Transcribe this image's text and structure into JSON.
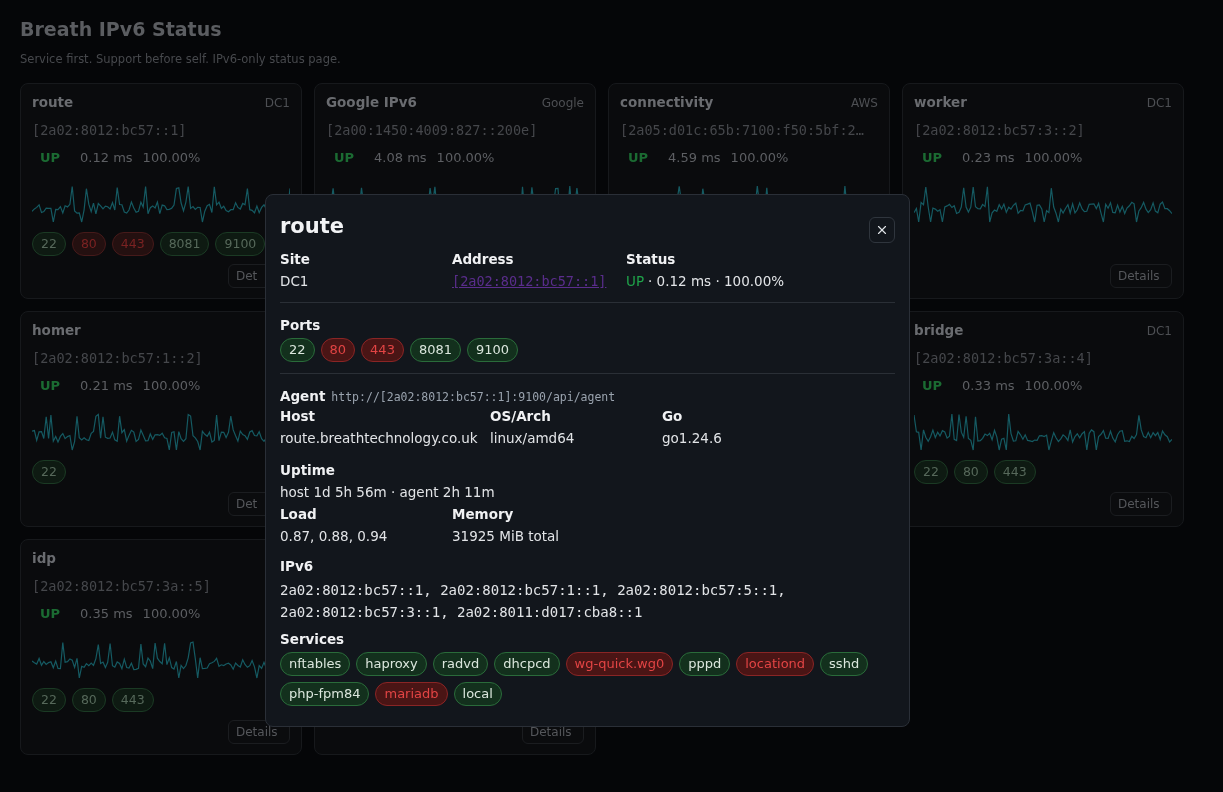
{
  "header": {
    "title": "Breath IPv6 Status",
    "subtitle": "Service first. Support before self. IPv6-only status page."
  },
  "cards": [
    {
      "kind": "monitor",
      "name": "route",
      "site": "DC1",
      "address": "[2a02:8012:bc57::1]",
      "status": {
        "state": "UP",
        "ok": true,
        "latency": "0.12 ms",
        "uptime": "100.00%"
      },
      "ports": [
        {
          "label": "22",
          "open": true
        },
        {
          "label": "80",
          "open": false
        },
        {
          "label": "443",
          "open": false
        },
        {
          "label": "8081",
          "open": true
        },
        {
          "label": "9100",
          "open": true
        }
      ],
      "details": "Det"
    },
    {
      "kind": "monitor",
      "name": "Google IPv6",
      "site": "Google",
      "address": "[2a00:1450:4009:827::200e]",
      "status": {
        "state": "UP",
        "ok": true,
        "latency": "4.08 ms",
        "uptime": "100.00%"
      }
    },
    {
      "kind": "monitor",
      "name": "connectivity",
      "site": "AWS",
      "address": "[2a05:d01c:65b:7100:f50:5bf:2…",
      "status": {
        "state": "UP",
        "ok": true,
        "latency": "4.59 ms",
        "uptime": "100.00%"
      }
    },
    {
      "kind": "monitor",
      "name": "worker",
      "site": "DC1",
      "address": "[2a02:8012:bc57:3::2]",
      "status": {
        "state": "UP",
        "ok": true,
        "latency": "0.23 ms",
        "uptime": "100.00%"
      },
      "details": "Details"
    },
    {
      "kind": "monitor",
      "name": "homer",
      "address": "[2a02:8012:bc57:1::2]",
      "status": {
        "state": "UP",
        "ok": true,
        "latency": "0.21 ms",
        "uptime": "100.00%"
      },
      "ports": [
        {
          "label": "22",
          "open": true
        }
      ],
      "details": "Det"
    },
    {
      "kind": "blank"
    },
    {
      "kind": "blank"
    },
    {
      "kind": "monitor",
      "name": "bridge",
      "site": "DC1",
      "address": "[2a02:8012:bc57:3a::4]",
      "status": {
        "state": "UP",
        "ok": true,
        "latency": "0.33 ms",
        "uptime": "100.00%"
      },
      "ports": [
        {
          "label": "22",
          "open": true
        },
        {
          "label": "80",
          "open": true
        },
        {
          "label": "443",
          "open": true
        }
      ],
      "details": "Details"
    },
    {
      "kind": "monitor",
      "name": "idp",
      "address": "[2a02:8012:bc57:3a::5]",
      "status": {
        "state": "UP",
        "ok": true,
        "latency": "0.35 ms",
        "uptime": "100.00%"
      },
      "ports": [
        {
          "label": "22",
          "open": true
        },
        {
          "label": "80",
          "open": true
        },
        {
          "label": "443",
          "open": true
        }
      ],
      "details": "Details"
    },
    {
      "kind": "monitor",
      "details": "Details"
    }
  ],
  "dialog": {
    "title": "route",
    "fields": [
      {
        "kind": "text",
        "label": "Site",
        "value": "DC1"
      },
      {
        "kind": "link",
        "label": "Address",
        "value": "[2a02:8012:bc57::1]"
      },
      {
        "kind": "status",
        "label": "Status",
        "state": "UP",
        "ok": true,
        "value": "· 0.12 ms · 100.00%"
      }
    ],
    "ports": {
      "label": "Ports",
      "items": [
        {
          "label": "22",
          "open": true
        },
        {
          "label": "80",
          "open": false
        },
        {
          "label": "443",
          "open": false
        },
        {
          "label": "8081",
          "open": true
        },
        {
          "label": "9100",
          "open": true
        }
      ]
    },
    "agent": {
      "label": "Agent",
      "url": "http://[2a02:8012:bc57::1]:9100/api/agent"
    },
    "host_fields": [
      {
        "label": "Host",
        "value": "route.breathtechnology.co.uk"
      },
      {
        "label": "OS/Arch",
        "value": "linux/amd64"
      },
      {
        "label": "Go",
        "value": "go1.24.6"
      }
    ],
    "uptime": {
      "label": "Uptime",
      "value": "host 1d 5h 56m · agent 2h 11m"
    },
    "resource_fields": [
      {
        "label": "Load",
        "value": "0.87, 0.88, 0.94"
      },
      {
        "label": "Memory",
        "value": "31925 MiB total"
      }
    ],
    "ipv6": {
      "label": "IPv6",
      "value": "2a02:8012:bc57::1, 2a02:8012:bc57:1::1, 2a02:8012:bc57:5::1, 2a02:8012:bc57:3::1, 2a02:8011:d017:cba8::1"
    },
    "services": {
      "label": "Services",
      "items": [
        {
          "label": "nftables",
          "ok": true
        },
        {
          "label": "haproxy",
          "ok": true
        },
        {
          "label": "radvd",
          "ok": true
        },
        {
          "label": "dhcpcd",
          "ok": true
        },
        {
          "label": "wg-quick.wg0",
          "ok": false
        },
        {
          "label": "pppd",
          "ok": true
        },
        {
          "label": "locationd",
          "ok": false
        },
        {
          "label": "sshd",
          "ok": true
        },
        {
          "label": "php-fpm84",
          "ok": true
        },
        {
          "label": "mariadb",
          "ok": false
        },
        {
          "label": "local",
          "ok": true
        }
      ]
    }
  }
}
